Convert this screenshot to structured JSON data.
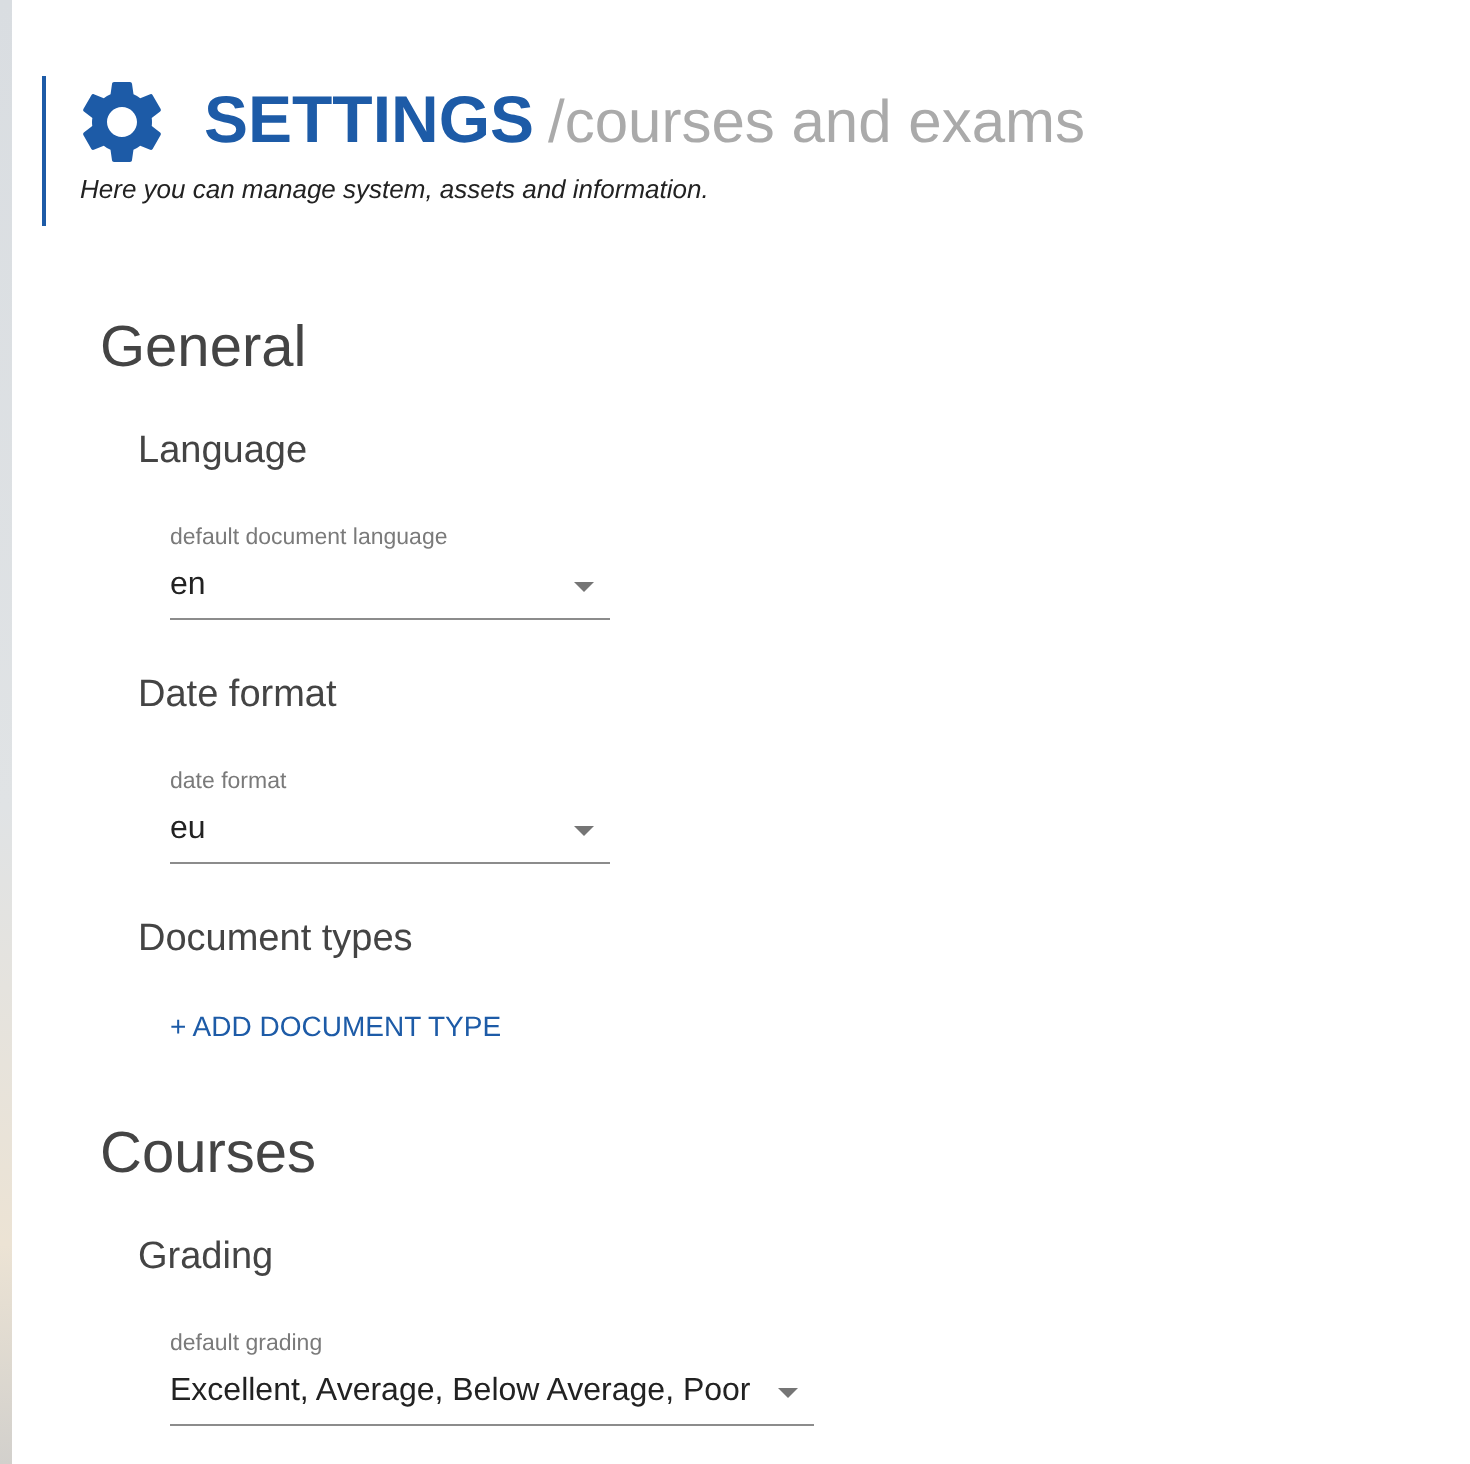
{
  "header": {
    "title": "SETTINGS",
    "subtitle": "/courses and exams",
    "description": "Here you can manage system, assets and information."
  },
  "sections": [
    {
      "title": "General",
      "groups": [
        {
          "title": "Language",
          "kind": "select",
          "field": {
            "label": "default document language",
            "value": "en"
          }
        },
        {
          "title": "Date format",
          "kind": "select",
          "field": {
            "label": "date format",
            "value": "eu"
          }
        },
        {
          "title": "Document types",
          "kind": "action",
          "action": {
            "label": "+ ADD DOCUMENT TYPE"
          }
        }
      ]
    },
    {
      "title": "Courses",
      "groups": [
        {
          "title": "Grading",
          "kind": "select",
          "field": {
            "label": "default grading",
            "value": "Excellent, Average, Below Average, Poor"
          }
        }
      ]
    }
  ]
}
